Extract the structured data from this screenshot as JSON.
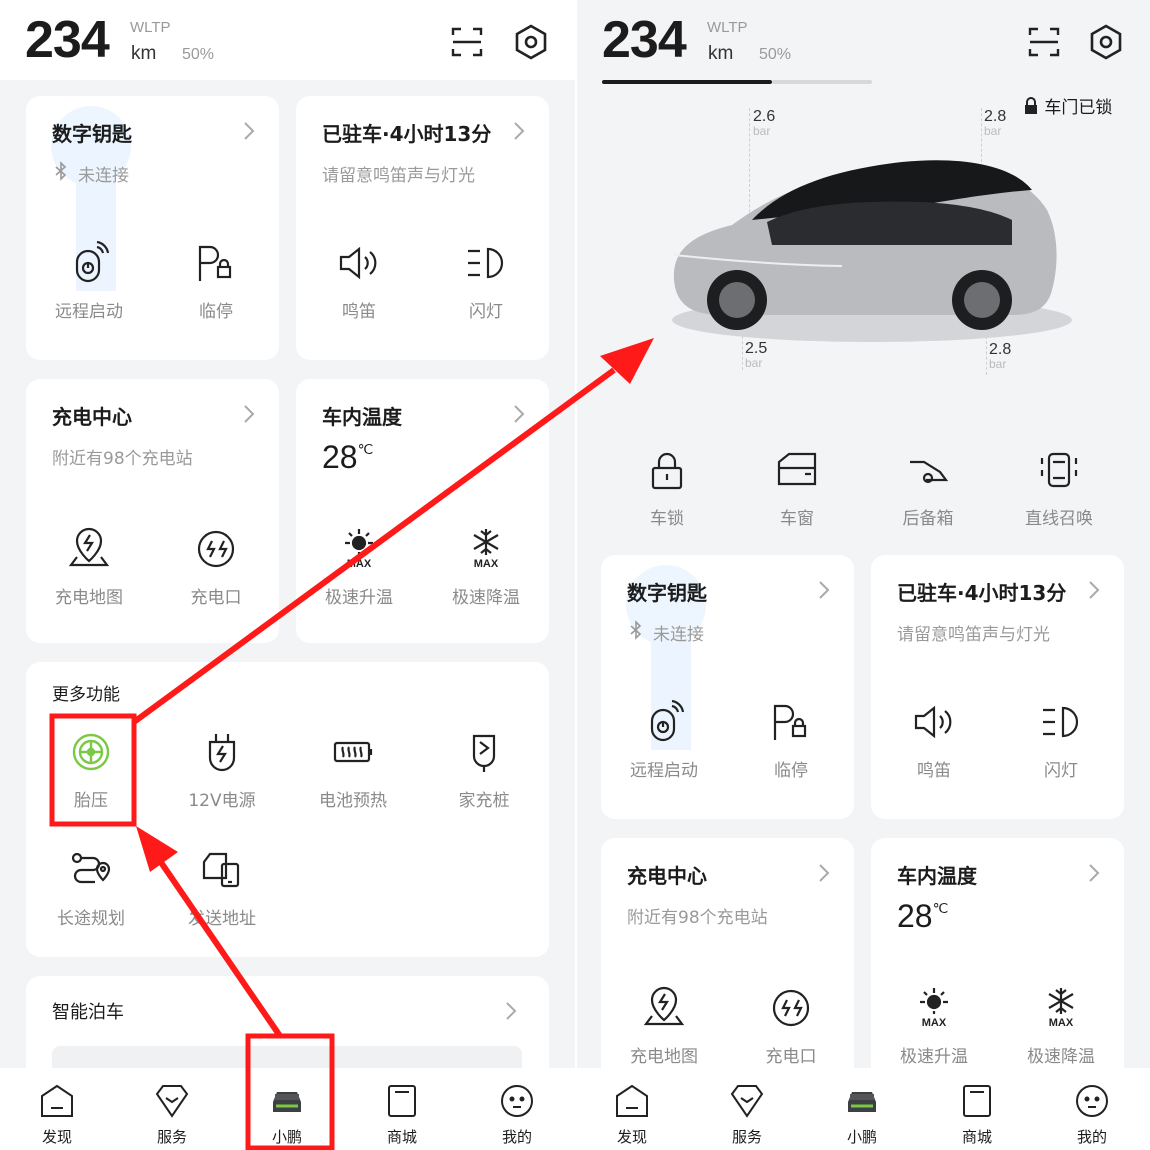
{
  "header": {
    "range": "234",
    "wltp": "WLTP",
    "unit": "km",
    "battery_pct": "50%",
    "battery_level": 0.5
  },
  "vehicle": {
    "lock_status": "车门已锁",
    "tires": {
      "front_left": {
        "value": "2.6",
        "unit": "bar"
      },
      "rear_left": {
        "value": "2.8",
        "unit": "bar"
      },
      "front_right": {
        "value": "2.5",
        "unit": "bar"
      },
      "rear_right": {
        "value": "2.8",
        "unit": "bar"
      }
    },
    "controls": [
      {
        "label": "车锁",
        "icon": "lock-icon"
      },
      {
        "label": "车窗",
        "icon": "window-icon"
      },
      {
        "label": "后备箱",
        "icon": "trunk-icon"
      },
      {
        "label": "直线召唤",
        "icon": "summon-icon"
      }
    ]
  },
  "digital_key": {
    "title": "数字钥匙",
    "status": "未连接",
    "actions": [
      {
        "label": "远程启动",
        "icon": "remote-start-icon"
      },
      {
        "label": "临停",
        "icon": "temp-park-icon"
      }
    ]
  },
  "parked": {
    "title": "已驻车·4小时13分",
    "subtitle": "请留意鸣笛声与灯光",
    "actions": [
      {
        "label": "鸣笛",
        "icon": "horn-icon"
      },
      {
        "label": "闪灯",
        "icon": "flash-light-icon"
      }
    ]
  },
  "charging": {
    "title": "充电中心",
    "subtitle": "附近有98个充电站",
    "actions": [
      {
        "label": "充电地图",
        "icon": "charge-map-icon"
      },
      {
        "label": "充电口",
        "icon": "charge-port-icon"
      }
    ]
  },
  "cabin_temp": {
    "title": "车内温度",
    "value": "28",
    "unit": "℃",
    "max_badge": "MAX",
    "actions": [
      {
        "label": "极速升温",
        "icon": "max-heat-icon"
      },
      {
        "label": "极速降温",
        "icon": "max-cool-icon"
      }
    ]
  },
  "more": {
    "title": "更多功能",
    "items": [
      {
        "label": "胎压",
        "icon": "tire-pressure-icon"
      },
      {
        "label": "12V电源",
        "icon": "12v-power-icon"
      },
      {
        "label": "电池预热",
        "icon": "battery-preheat-icon"
      },
      {
        "label": "家充桩",
        "icon": "home-charger-icon"
      },
      {
        "label": "长途规划",
        "icon": "trip-planning-icon"
      },
      {
        "label": "发送地址",
        "icon": "send-address-icon"
      }
    ]
  },
  "parking": {
    "title": "智能泊车"
  },
  "tabs": [
    {
      "label": "发现",
      "icon": "discover-icon"
    },
    {
      "label": "服务",
      "icon": "service-icon"
    },
    {
      "label": "小鹏",
      "icon": "car-icon"
    },
    {
      "label": "商城",
      "icon": "mall-icon"
    },
    {
      "label": "我的",
      "icon": "profile-icon"
    }
  ],
  "colors": {
    "accent_green": "#7ac943",
    "annotation_red": "#ff1a1a",
    "card_bg": "#ffffff",
    "page_bg": "#f3f4f6"
  }
}
